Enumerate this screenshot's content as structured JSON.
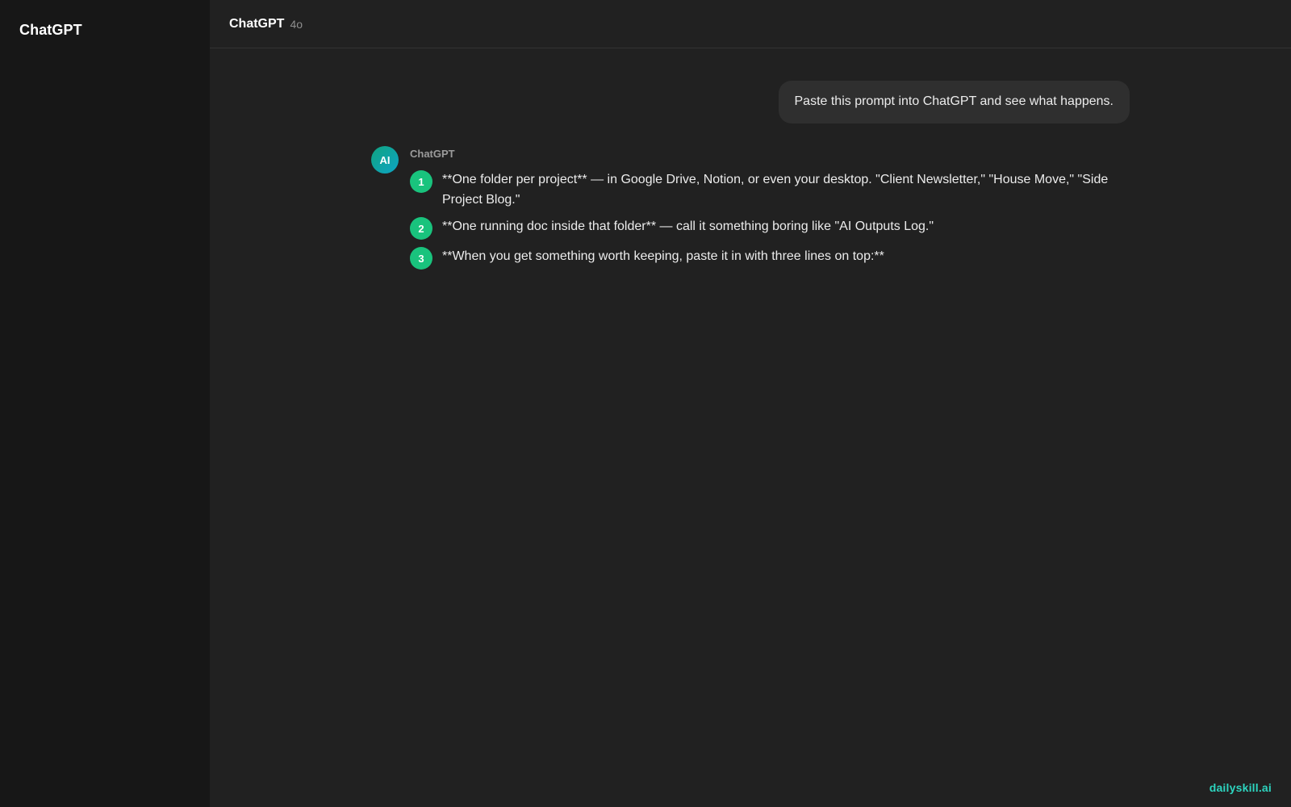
{
  "sidebar": {
    "brand": "ChatGPT"
  },
  "header": {
    "title": "ChatGPT",
    "model": "4o"
  },
  "conversation": {
    "user_message": "Paste this prompt into ChatGPT and see what happens.",
    "assistant": {
      "avatar_text": "AI",
      "name": "ChatGPT",
      "steps": [
        {
          "num": "1",
          "text": "**One folder per project** — in Google Drive, Notion, or even your desktop. \"Client Newsletter,\" \"House Move,\" \"Side Project Blog.\""
        },
        {
          "num": "2",
          "text": "**One running doc inside that folder** — call it something boring like \"AI Outputs Log.\""
        },
        {
          "num": "3",
          "text": "**When you get something worth keeping, paste it in with three lines on top:**"
        }
      ]
    }
  },
  "watermark": "dailyskill.ai",
  "colors": {
    "sidebar_bg": "#171717",
    "main_bg": "#212121",
    "bubble_bg": "#2f2f2f",
    "step_badge": "#19c37d",
    "watermark": "#2dd4bf"
  }
}
